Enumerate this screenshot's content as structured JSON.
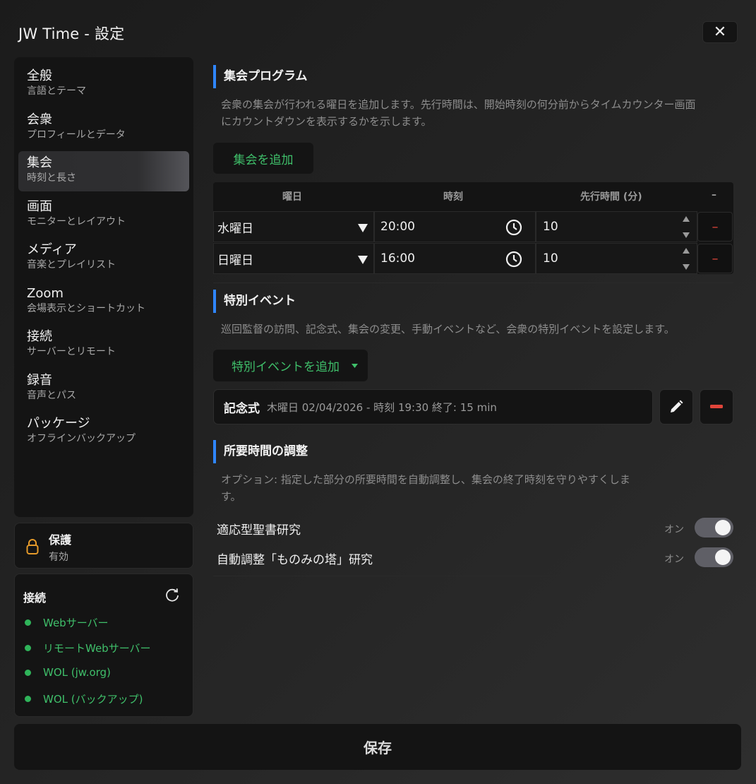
{
  "window": {
    "title": "JW Time - 設定",
    "close_glyph": "✕"
  },
  "sidebar": {
    "items": [
      {
        "label": "全般",
        "sub": "言語とテーマ"
      },
      {
        "label": "会衆",
        "sub": "プロフィールとデータ"
      },
      {
        "label": "集会",
        "sub": "時刻と長さ",
        "active": true
      },
      {
        "label": "画面",
        "sub": "モニターとレイアウト"
      },
      {
        "label": "メディア",
        "sub": "音楽とプレイリスト"
      },
      {
        "label": "Zoom",
        "sub": "会場表示とショートカット"
      },
      {
        "label": "接続",
        "sub": "サーバーとリモート"
      },
      {
        "label": "録音",
        "sub": "音声とパス"
      },
      {
        "label": "パッケージ",
        "sub": "オフラインバックアップ"
      }
    ]
  },
  "protection": {
    "title": "保護",
    "status": "有効",
    "icon": "lock-icon"
  },
  "connection": {
    "title": "接続",
    "items": [
      "Webサーバー",
      "リモートWebサーバー",
      "WOL (jw.org)",
      "WOL (バックアップ)"
    ],
    "status_color": "#2fb45a"
  },
  "meetings": {
    "heading": "集会プログラム",
    "desc_line1": "会衆の集会が行われる曜日を追加します。先行時間は、開始時刻の何分前からタイムカウンター画面",
    "desc_line2": "にカウントダウンを表示するかを示します。",
    "add_label": "集会を追加",
    "columns": {
      "day": "曜日",
      "time": "時刻",
      "lead": "先行時間 (分)",
      "remove": "–"
    },
    "rows": [
      {
        "day": "水曜日",
        "time": "20:00",
        "lead": "10",
        "remove": "–"
      },
      {
        "day": "日曜日",
        "time": "16:00",
        "lead": "10",
        "remove": "–"
      }
    ]
  },
  "events": {
    "heading": "特別イベント",
    "desc": "巡回監督の訪問、記念式、集会の変更、手動イベントなど、会衆の特別イベントを設定します。",
    "add_label": "特別イベントを追加",
    "items": [
      {
        "name": "記念式",
        "detail": "木曜日 02/04/2026 - 時刻 19:30 終了: 15 min"
      }
    ]
  },
  "duration": {
    "heading": "所要時間の調整",
    "desc_line1": "オプション: 指定した部分の所要時間を自動調整し、集会の終了時刻を守りやすくしま",
    "desc_line2": "す。",
    "toggles": [
      {
        "label": "適応型聖書研究",
        "state": "オン",
        "on": true
      },
      {
        "label": "自動調整「ものみの塔」研究",
        "state": "オン",
        "on": true
      }
    ]
  },
  "footer": {
    "save_label": "保存"
  },
  "colors": {
    "accent": "#2f86ff",
    "green": "#3fbf6a",
    "danger": "#e0453a"
  }
}
